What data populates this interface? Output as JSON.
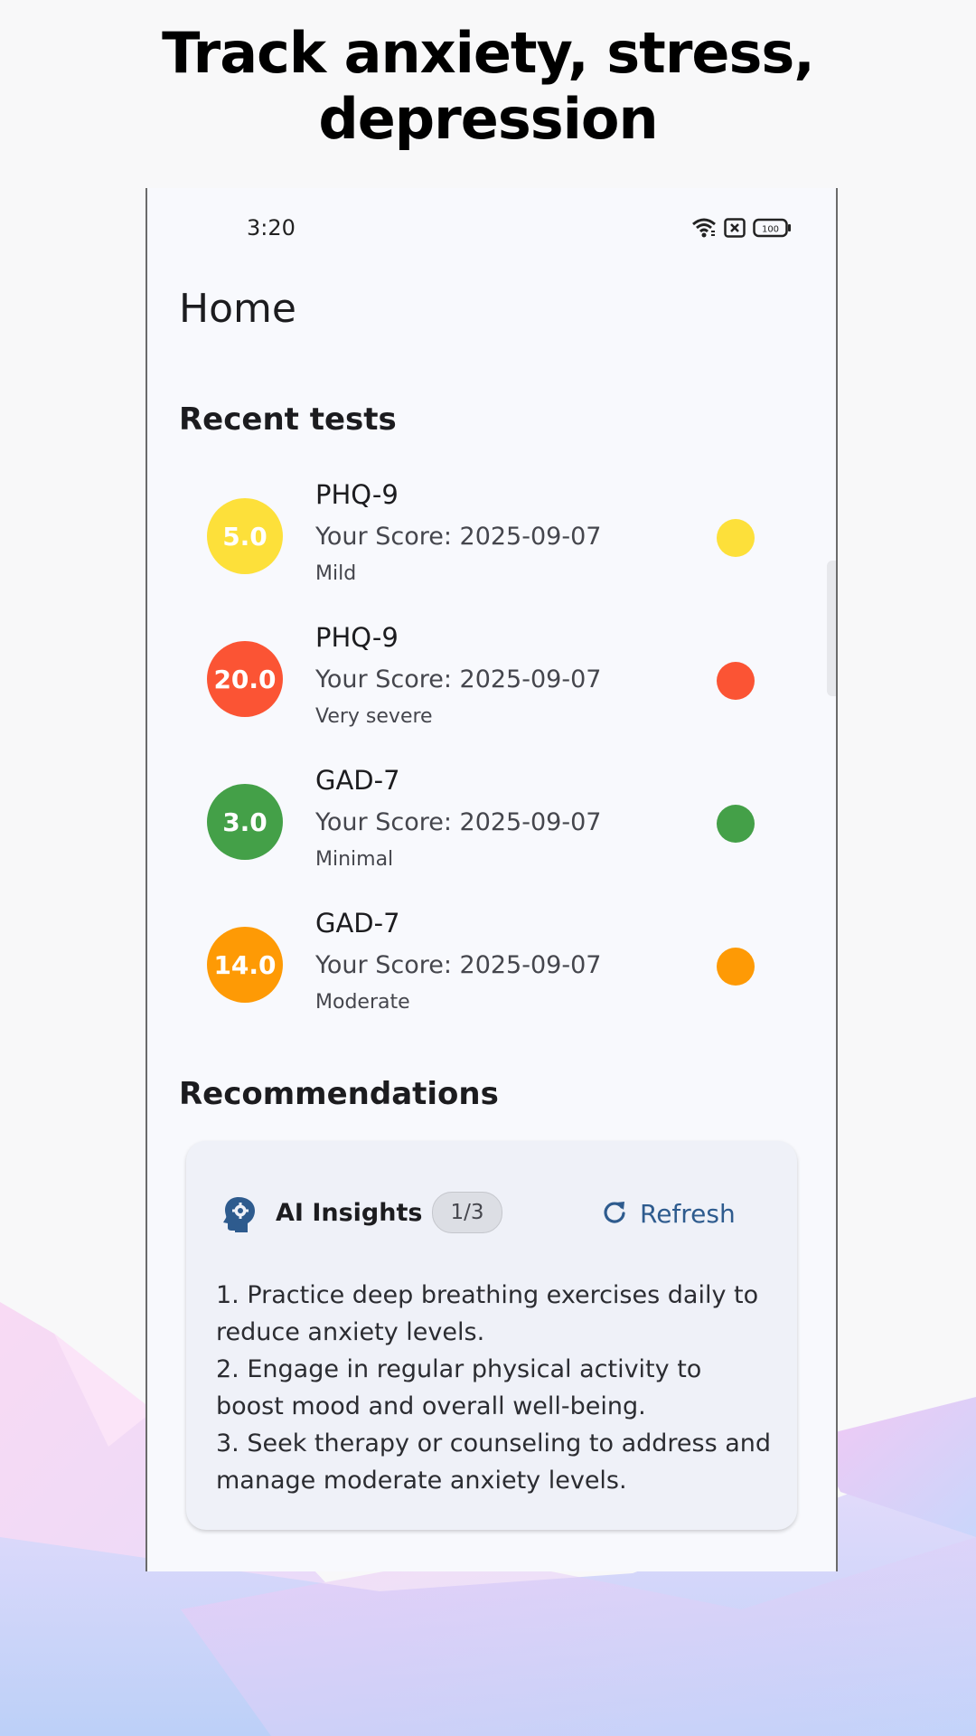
{
  "headline": "Track anxiety, stress, depression",
  "status_bar": {
    "time": "3:20",
    "battery": "100",
    "icons": [
      "wifi-icon",
      "notification-icon",
      "battery-icon"
    ]
  },
  "page_title": "Home",
  "recent_tests": {
    "title": "Recent tests",
    "items": [
      {
        "score": "5.0",
        "name": "PHQ-9",
        "score_line": "Your Score: 2025-09-07",
        "level": "Mild",
        "color": "#fde03a"
      },
      {
        "score": "20.0",
        "name": "PHQ-9",
        "score_line": "Your Score: 2025-09-07",
        "level": "Very severe",
        "color": "#fb5434"
      },
      {
        "score": "3.0",
        "name": "GAD-7",
        "score_line": "Your Score: 2025-09-07",
        "level": "Minimal",
        "color": "#44a048"
      },
      {
        "score": "14.0",
        "name": "GAD-7",
        "score_line": "Your Score: 2025-09-07",
        "level": "Moderate",
        "color": "#fe9a05"
      }
    ]
  },
  "recommendations": {
    "title": "Recommendations",
    "card": {
      "icon": "head-gear-icon",
      "label": "AI Insights",
      "badge": "1/3",
      "refresh_label": "Refresh",
      "items": [
        "1. Practice deep breathing exercises daily to reduce anxiety levels.",
        "2. Engage in regular physical activity to boost mood and overall well-being.",
        "3. Seek therapy or counseling to address and manage moderate anxiety levels."
      ]
    }
  },
  "colors": {
    "accent": "#2e5b8e",
    "background": "#f8f9fd"
  }
}
